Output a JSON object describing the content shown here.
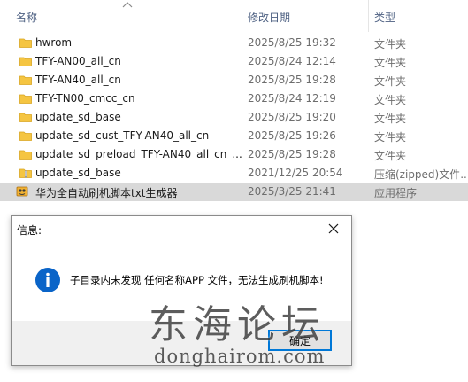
{
  "columns": {
    "name": "名称",
    "date": "修改日期",
    "type": "类型"
  },
  "files": [
    {
      "name": "hwrom",
      "date": "2025/8/25 19:32",
      "type": "文件夹",
      "icon": "folder-icon"
    },
    {
      "name": "TFY-AN00_all_cn",
      "date": "2025/8/24 12:14",
      "type": "文件夹",
      "icon": "folder-icon"
    },
    {
      "name": "TFY-AN40_all_cn",
      "date": "2025/8/25 19:28",
      "type": "文件夹",
      "icon": "folder-icon"
    },
    {
      "name": "TFY-TN00_cmcc_cn",
      "date": "2025/8/24 12:19",
      "type": "文件夹",
      "icon": "folder-icon"
    },
    {
      "name": "update_sd_base",
      "date": "2025/8/25 19:20",
      "type": "文件夹",
      "icon": "folder-icon"
    },
    {
      "name": "update_sd_cust_TFY-AN40_all_cn",
      "date": "2025/8/25 19:26",
      "type": "文件夹",
      "icon": "folder-icon"
    },
    {
      "name": "update_sd_preload_TFY-AN40_all_cn_...",
      "date": "2025/8/25 19:28",
      "type": "文件夹",
      "icon": "folder-icon"
    },
    {
      "name": "update_sd_base",
      "date": "2021/12/25 20:54",
      "type": "压缩(zipped)文件...",
      "icon": "zip-folder-icon"
    },
    {
      "name": "华为全自动刷机脚本txt生成器",
      "date": "2025/3/25 21:41",
      "type": "应用程序",
      "icon": "app-icon"
    }
  ],
  "dialog": {
    "title": "信息:",
    "message": "子目录内未发现 任何名称APP 文件，无法生成刷机脚本!",
    "ok_label": "确定"
  },
  "watermark": {
    "cn": "东海论坛",
    "en": "donghairom.com"
  },
  "colors": {
    "folder": "#f5c542",
    "selected_row": "#d9d9d9",
    "info": "#0a64c8",
    "focus_border": "#0078d7"
  }
}
